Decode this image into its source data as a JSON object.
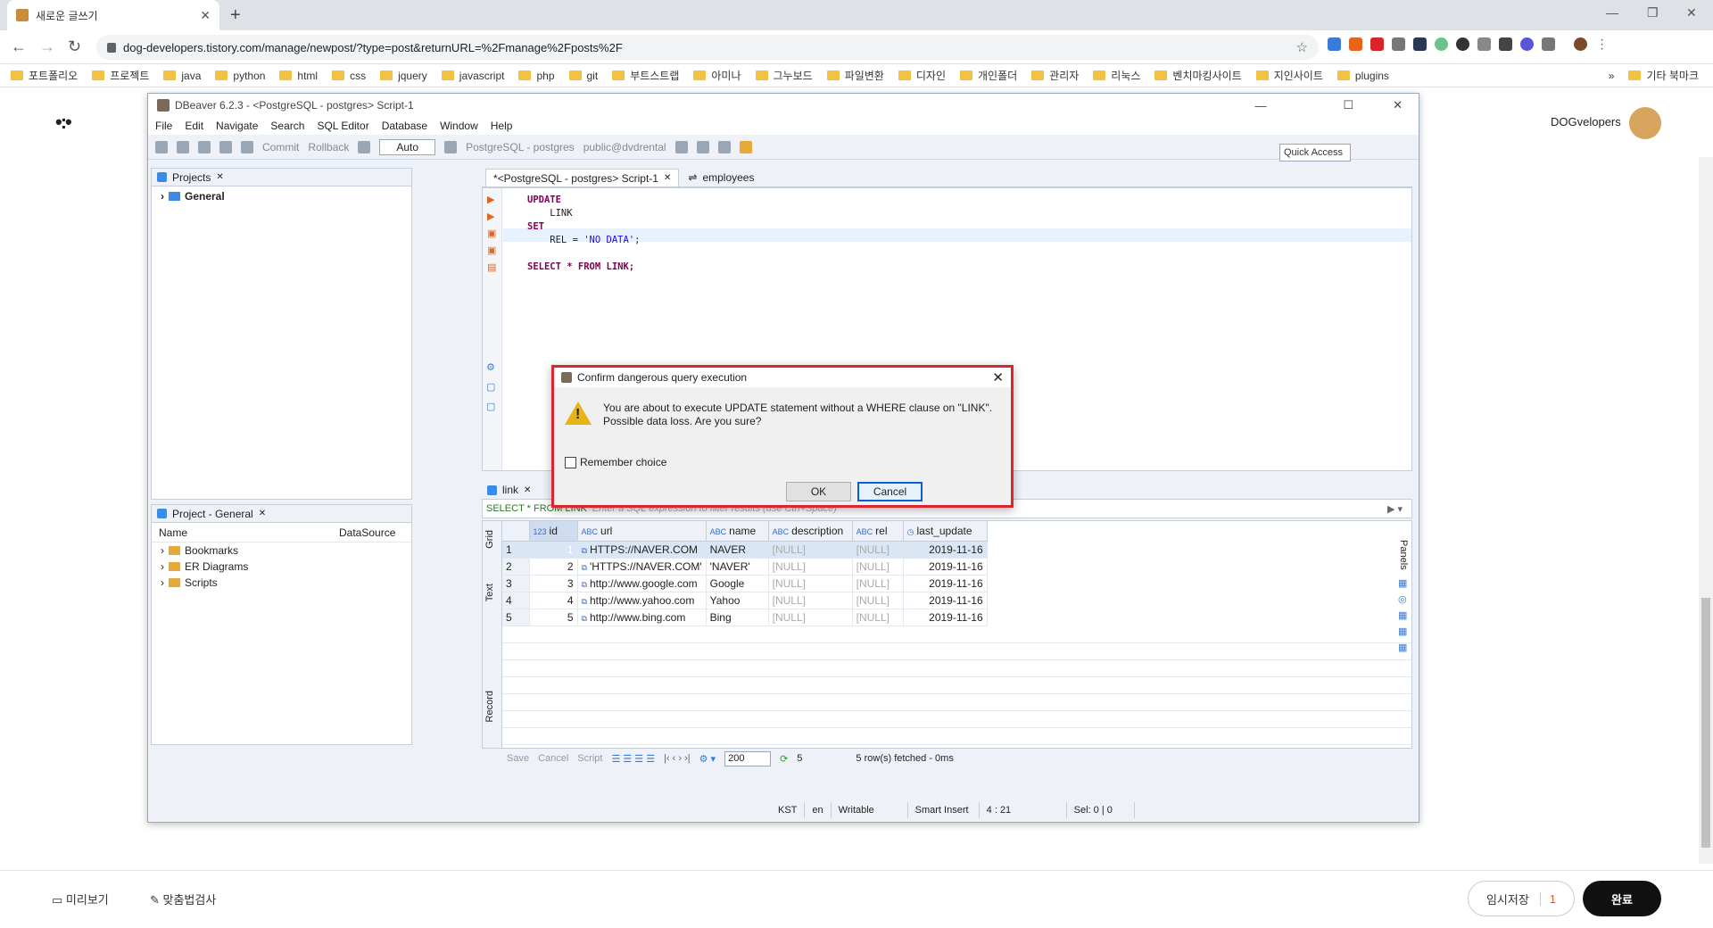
{
  "browser": {
    "tab_title": "새로운 글쓰기",
    "url": "dog-developers.tistory.com/manage/newpost/?type=post&returnURL=%2Fmanage%2Fposts%2F",
    "bookmarks": [
      "포트폴리오",
      "프로젝트",
      "java",
      "python",
      "html",
      "css",
      "jquery",
      "javascript",
      "php",
      "git",
      "부트스트랩",
      "아미나",
      "그누보드",
      "파일변환",
      "디자인",
      "개인폴더",
      "관리자",
      "리눅스",
      "벤치마킹사이트",
      "지인사이트",
      "plugins"
    ],
    "bookmarks_more": "»",
    "other_bookmarks": "기타 북마크"
  },
  "tistory": {
    "user": "DOGvelopers",
    "preview_label": "미리보기",
    "spell_label": "맞춤법검사",
    "draft_label": "임시저장",
    "draft_count": "1",
    "done_label": "완료"
  },
  "dbeaver": {
    "title": "DBeaver 6.2.3 - <PostgreSQL - postgres> Script-1",
    "menu": [
      "File",
      "Edit",
      "Navigate",
      "Search",
      "SQL Editor",
      "Database",
      "Window",
      "Help"
    ],
    "toolbar": {
      "commit": "Commit",
      "rollback": "Rollback",
      "mode": "Auto",
      "connection": "PostgreSQL - postgres",
      "schema": "public@dvdrental",
      "quick_access": "Quick Access"
    },
    "projects_tab": "Projects",
    "project_root": "General",
    "project_general_tab": "Project - General",
    "project_cols": [
      "Name",
      "DataSource"
    ],
    "project_items": [
      "Bookmarks",
      "ER Diagrams",
      "Scripts"
    ],
    "editor_tabs": [
      "*<PostgreSQL - postgres> Script-1",
      "employees"
    ],
    "code": {
      "l1": "UPDATE",
      "l2": "    LINK",
      "l3": "SET",
      "l4a": "    REL = ",
      "l4b": "'NO DATA'",
      "l4c": ";",
      "l6": "SELECT * FROM LINK;"
    },
    "results_tab": "link",
    "filter_query": "SELECT * FROM LINK",
    "filter_placeholder": "Enter a SQL expression to filter results (use Ctrl+Space)",
    "vtabs": [
      "Grid",
      "Text",
      "Record"
    ],
    "panels_label": "Panels",
    "columns": [
      {
        "type": "123",
        "name": "id"
      },
      {
        "type": "ABC",
        "name": "url"
      },
      {
        "type": "ABC",
        "name": "name"
      },
      {
        "type": "ABC",
        "name": "description"
      },
      {
        "type": "ABC",
        "name": "rel"
      },
      {
        "type": "",
        "name": "last_update"
      }
    ],
    "rows": [
      {
        "rn": "1",
        "id": "1",
        "url": "HTTPS://NAVER.COM",
        "name": "NAVER",
        "description": "[NULL]",
        "rel": "[NULL]",
        "last_update": "2019-11-16"
      },
      {
        "rn": "2",
        "id": "2",
        "url": "'HTTPS://NAVER.COM'",
        "name": "'NAVER'",
        "description": "[NULL]",
        "rel": "[NULL]",
        "last_update": "2019-11-16"
      },
      {
        "rn": "3",
        "id": "3",
        "url": "http://www.google.com",
        "name": "Google",
        "description": "[NULL]",
        "rel": "[NULL]",
        "last_update": "2019-11-16"
      },
      {
        "rn": "4",
        "id": "4",
        "url": "http://www.yahoo.com",
        "name": "Yahoo",
        "description": "[NULL]",
        "rel": "[NULL]",
        "last_update": "2019-11-16"
      },
      {
        "rn": "5",
        "id": "5",
        "url": "http://www.bing.com",
        "name": "Bing",
        "description": "[NULL]",
        "rel": "[NULL]",
        "last_update": "2019-11-16"
      }
    ],
    "gridbar": {
      "save": "Save",
      "cancel": "Cancel",
      "script": "Script",
      "fetch_size": "200",
      "refresh_count": "5",
      "rows_fetched": "5 row(s) fetched - 0ms"
    },
    "status": {
      "tz": "KST",
      "lang": "en",
      "mode": "Writable",
      "insert": "Smart Insert",
      "pos": "4 : 21",
      "sel": "Sel: 0 | 0"
    }
  },
  "dialog": {
    "title": "Confirm dangerous query execution",
    "message_l1": "You are about to execute UPDATE statement without a WHERE clause on \"LINK\".",
    "message_l2": "Possible data loss. Are you sure?",
    "remember": "Remember choice",
    "ok": "OK",
    "cancel": "Cancel"
  },
  "colors": {
    "highlight_red": "#d9262f",
    "selection_blue": "#3a7ad3",
    "warning_yellow": "#e7b416"
  }
}
